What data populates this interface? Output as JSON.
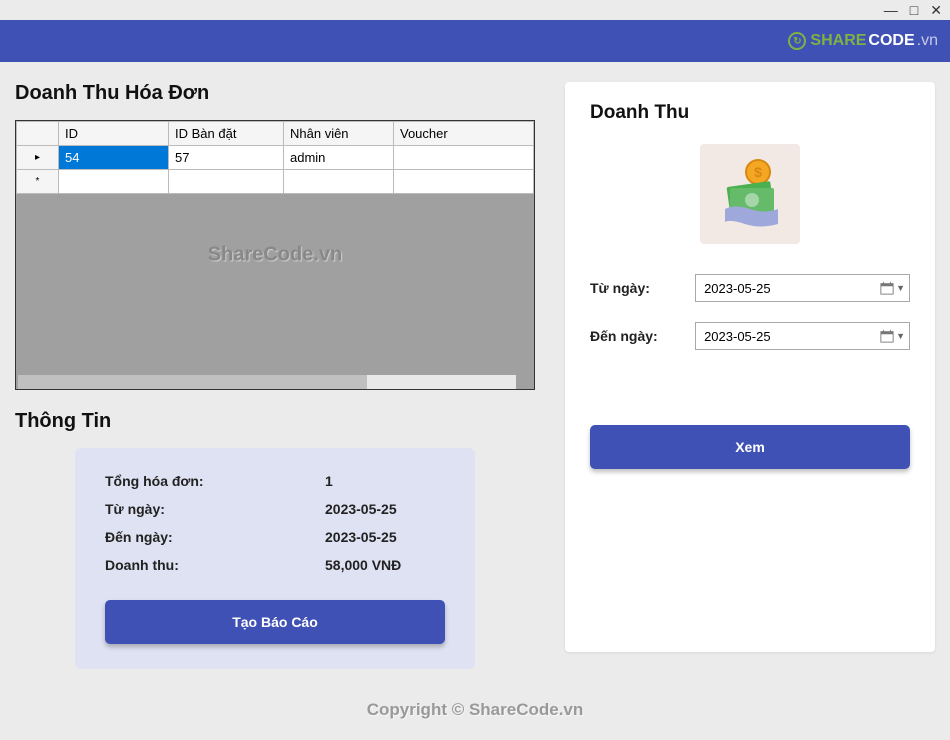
{
  "window": {
    "minimize": "—",
    "maximize": "□",
    "close": "✕"
  },
  "header": {
    "logo_brand": "SHARE",
    "logo_suffix": "CODE",
    "logo_tld": ".vn"
  },
  "left": {
    "title": "Doanh Thu Hóa Đơn",
    "table": {
      "columns": {
        "id": "ID",
        "ban": "ID Bàn đặt",
        "nv": "Nhân viên",
        "voucher": "Voucher"
      },
      "rows": [
        {
          "marker": "▸",
          "id": "54",
          "ban": "57",
          "nv": "admin",
          "voucher": ""
        },
        {
          "marker": "*",
          "id": "",
          "ban": "",
          "nv": "",
          "voucher": ""
        }
      ]
    },
    "watermark": "ShareCode.vn",
    "info_title": "Thông Tin",
    "info": {
      "total_label": "Tổng hóa đơn:",
      "total_value": "1",
      "from_label": "Từ ngày:",
      "from_value": "2023-05-25",
      "to_label": "Đến ngày:",
      "to_value": "2023-05-25",
      "revenue_label": "Doanh thu:",
      "revenue_value": "58,000 VNĐ"
    },
    "report_btn": "Tạo Báo Cáo"
  },
  "right": {
    "title": "Doanh Thu",
    "from_label": "Từ ngày:",
    "from_value": "2023-05-25",
    "to_label": "Đến ngày:",
    "to_value": "2023-05-25",
    "view_btn": "Xem"
  },
  "footer": "Copyright © ShareCode.vn"
}
